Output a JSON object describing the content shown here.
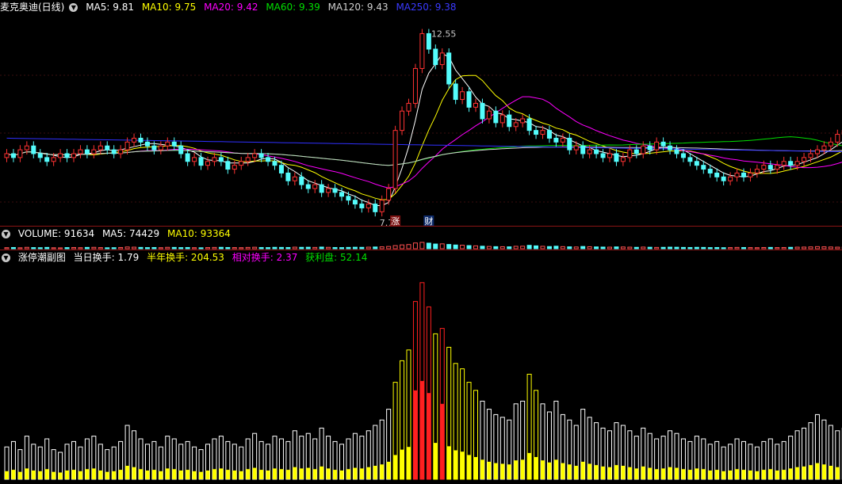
{
  "stock": {
    "title": "麦克奥迪(日线)"
  },
  "kline_header": {
    "ma5": "MA5: 9.81",
    "ma10": "MA10: 9.75",
    "ma20": "MA20: 9.42",
    "ma60": "MA60: 9.39",
    "ma120": "MA120: 9.43",
    "ma250": "MA250: 9.38"
  },
  "kline_labels": {
    "high": "12.55",
    "low": "7.70",
    "limit_up": "涨",
    "finance": "财"
  },
  "volume_header": {
    "title": "VOLUME: 91634",
    "ma5": "MA5: 74429",
    "ma10": "MA10: 93364"
  },
  "indicator_header": {
    "name": "涨停潮副图",
    "day_turnover": "当日换手: 1.79",
    "half_year_turnover": "半年换手: 204.53",
    "relative_turnover": "相对换手: 2.37",
    "profit_ratio": "获利盘: 52.14"
  },
  "colors": {
    "up": "#ff3232",
    "down": "#54fcfc",
    "ma5": "#ffffff",
    "ma10": "#ffff00",
    "ma20": "#ff00ff",
    "ma60": "#00e000",
    "ma120": "#d0d0d0",
    "ma250": "#3030ff",
    "bar_white": "#ffffff",
    "bar_yellow": "#ffff00",
    "bar_red": "#ff2020"
  },
  "chart_data": {
    "type": "candlestick",
    "price_range": [
      7.4,
      12.8
    ],
    "closes": [
      9.2,
      9.1,
      9.3,
      9.4,
      9.2,
      9.1,
      9.0,
      9.1,
      9.2,
      9.1,
      9.2,
      9.3,
      9.2,
      9.3,
      9.4,
      9.3,
      9.2,
      9.3,
      9.5,
      9.6,
      9.5,
      9.4,
      9.3,
      9.4,
      9.5,
      9.4,
      9.2,
      9.0,
      9.1,
      8.9,
      9.0,
      9.1,
      9.0,
      8.8,
      8.9,
      9.0,
      9.1,
      9.2,
      9.1,
      9.0,
      8.9,
      8.7,
      8.5,
      8.6,
      8.4,
      8.3,
      8.4,
      8.2,
      8.3,
      8.2,
      8.1,
      8.0,
      7.9,
      7.8,
      7.9,
      7.7,
      8.0,
      8.3,
      9.8,
      10.3,
      10.5,
      11.4,
      12.3,
      11.9,
      11.5,
      11.8,
      11.0,
      10.6,
      10.8,
      10.4,
      10.5,
      10.1,
      10.3,
      10.0,
      10.2,
      9.9,
      10.0,
      10.1,
      9.8,
      9.7,
      9.8,
      9.6,
      9.5,
      9.6,
      9.3,
      9.4,
      9.2,
      9.3,
      9.2,
      9.1,
      9.2,
      9.0,
      9.1,
      9.3,
      9.2,
      9.4,
      9.3,
      9.5,
      9.4,
      9.3,
      9.2,
      9.1,
      9.0,
      8.9,
      8.8,
      8.7,
      8.6,
      8.5,
      8.6,
      8.7,
      8.6,
      8.7,
      8.8,
      8.9,
      8.8,
      8.9,
      9.0,
      8.9,
      9.0,
      9.1,
      9.2,
      9.3,
      9.4,
      9.5,
      9.7,
      9.8
    ],
    "turnover": [
      1.2,
      1.4,
      1.1,
      1.6,
      1.3,
      1.2,
      1.5,
      1.1,
      1.0,
      1.3,
      1.4,
      1.2,
      1.5,
      1.6,
      1.3,
      1.1,
      1.2,
      1.4,
      2.0,
      1.8,
      1.5,
      1.3,
      1.4,
      1.2,
      1.6,
      1.5,
      1.3,
      1.4,
      1.2,
      1.1,
      1.3,
      1.5,
      1.6,
      1.4,
      1.3,
      1.2,
      1.5,
      1.7,
      1.4,
      1.3,
      1.6,
      1.5,
      1.4,
      1.8,
      1.6,
      1.7,
      1.5,
      1.9,
      1.6,
      1.4,
      1.3,
      1.5,
      1.7,
      1.6,
      1.8,
      2.0,
      2.2,
      2.6,
      3.6,
      4.4,
      4.8,
      6.6,
      7.3,
      6.4,
      5.4,
      5.6,
      4.9,
      4.3,
      4.1,
      3.6,
      3.3,
      2.9,
      2.6,
      2.4,
      2.3,
      2.2,
      2.8,
      2.9,
      3.9,
      3.3,
      2.8,
      2.5,
      2.9,
      2.4,
      2.2,
      2.0,
      2.6,
      2.3,
      2.1,
      1.9,
      1.8,
      2.1,
      2.0,
      1.8,
      1.6,
      1.9,
      1.7,
      1.5,
      1.6,
      1.8,
      1.7,
      1.5,
      1.4,
      1.6,
      1.5,
      1.3,
      1.4,
      1.2,
      1.3,
      1.5,
      1.4,
      1.3,
      1.2,
      1.4,
      1.5,
      1.3,
      1.4,
      1.6,
      1.8,
      1.9,
      2.1,
      2.4,
      2.2,
      2.0,
      1.8,
      1.9
    ]
  }
}
